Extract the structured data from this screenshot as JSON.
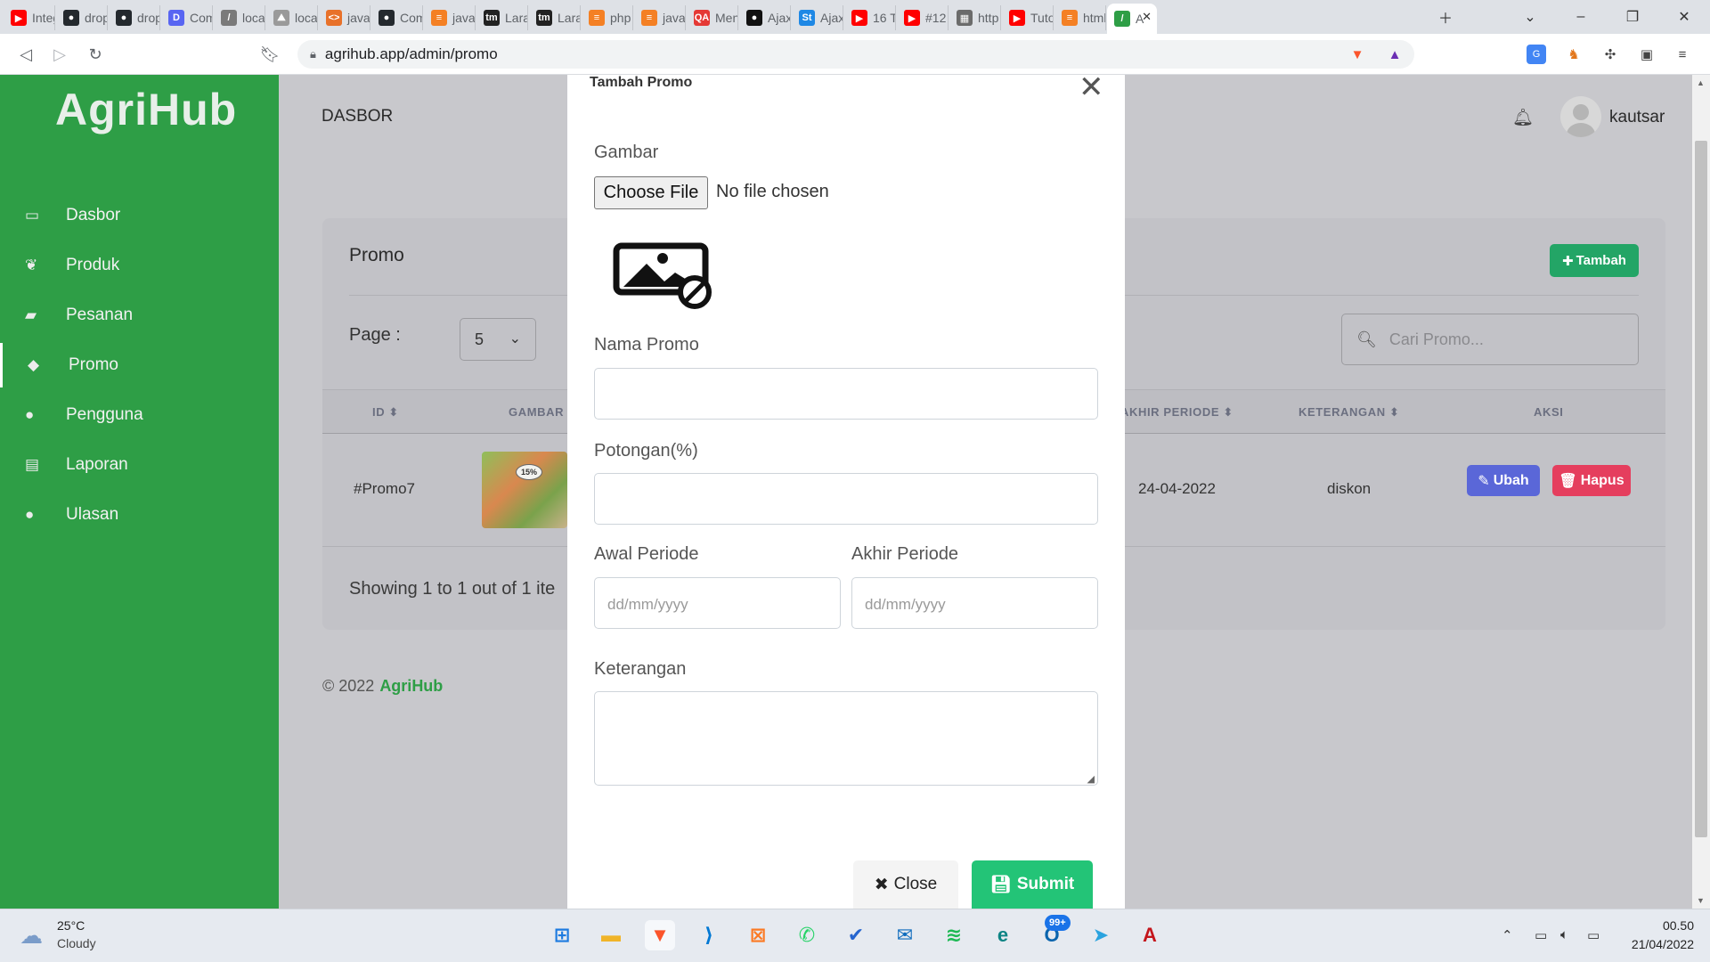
{
  "browser": {
    "tabs": [
      {
        "label": "Integ",
        "icon": "youtube-icon",
        "color": "#ff0000",
        "glyph": "▶"
      },
      {
        "label": "drop",
        "icon": "github-icon",
        "color": "#24292e",
        "glyph": "●"
      },
      {
        "label": "drop",
        "icon": "github-icon",
        "color": "#24292e",
        "glyph": "●"
      },
      {
        "label": "Com",
        "icon": "discord-icon",
        "color": "#5865f2",
        "glyph": "D"
      },
      {
        "label": "local",
        "icon": "leaf-icon",
        "color": "#7a7a7a",
        "glyph": "/"
      },
      {
        "label": "local",
        "icon": "phpmyadmin-icon",
        "color": "#9a9a9a",
        "glyph": "⛰"
      },
      {
        "label": "javas",
        "icon": "code-icon",
        "color": "#e8712a",
        "glyph": "<>"
      },
      {
        "label": "Com",
        "icon": "github-icon",
        "color": "#24292e",
        "glyph": "●"
      },
      {
        "label": "javas",
        "icon": "stackoverflow-icon",
        "color": "#f48024",
        "glyph": "≡"
      },
      {
        "label": "Lara",
        "icon": "tm-icon",
        "color": "#222222",
        "glyph": "tm"
      },
      {
        "label": "Lara",
        "icon": "tm-icon",
        "color": "#222222",
        "glyph": "tm"
      },
      {
        "label": "php",
        "icon": "stackoverflow-icon",
        "color": "#f48024",
        "glyph": "≡"
      },
      {
        "label": "javas",
        "icon": "stackoverflow-icon",
        "color": "#f48024",
        "glyph": "≡"
      },
      {
        "label": "Men",
        "icon": "qa-icon",
        "color": "#e53935",
        "glyph": "QA"
      },
      {
        "label": "Ajax",
        "icon": "globe-icon",
        "color": "#111111",
        "glyph": "●"
      },
      {
        "label": "Ajax",
        "icon": "st-icon",
        "color": "#1e88e5",
        "glyph": "St"
      },
      {
        "label": "16 T",
        "icon": "youtube-icon",
        "color": "#ff0000",
        "glyph": "▶"
      },
      {
        "label": "#12",
        "icon": "youtube-icon",
        "color": "#ff0000",
        "glyph": "▶"
      },
      {
        "label": "http",
        "icon": "page-icon",
        "color": "#6b6b6b",
        "glyph": "▦"
      },
      {
        "label": "Tuto",
        "icon": "youtube-icon",
        "color": "#ff0000",
        "glyph": "▶"
      },
      {
        "label": "html",
        "icon": "stackoverflow-icon",
        "color": "#f48024",
        "glyph": "≡"
      },
      {
        "label": "A",
        "icon": "leaf-icon",
        "color": "#2e9e46",
        "glyph": "/",
        "active": true
      }
    ],
    "url": "agrihub.app/admin/promo"
  },
  "sidebar": {
    "logo": "AgriHub",
    "items": [
      {
        "label": "Dasbor",
        "icon": "monitor-icon",
        "glyph": "▭"
      },
      {
        "label": "Produk",
        "icon": "leaf-icon",
        "glyph": "❦"
      },
      {
        "label": "Pesanan",
        "icon": "shopping-bag-icon",
        "glyph": "▰"
      },
      {
        "label": "Promo",
        "icon": "tag-icon",
        "glyph": "◆",
        "active": true
      },
      {
        "label": "Pengguna",
        "icon": "user-icon",
        "glyph": "●"
      },
      {
        "label": "Laporan",
        "icon": "report-icon",
        "glyph": "▤"
      },
      {
        "label": "Ulasan",
        "icon": "chat-icon",
        "glyph": "●"
      }
    ]
  },
  "topbar": {
    "title": "DASBOR",
    "username": "kautsar"
  },
  "card": {
    "title": "Promo",
    "add_label": "Tambah",
    "page_label": "Page :",
    "page_value": "5",
    "search_placeholder": "Cari Promo...",
    "columns": {
      "id": "ID",
      "gambar": "GAMBAR",
      "akhir_periode": "AKHIR PERIODE",
      "keterangan": "KETERANGAN",
      "aksi": "AKSI"
    },
    "row": {
      "id": "#Promo7",
      "image_badge": "15%",
      "akhir_periode": "24-04-2022",
      "keterangan": "diskon",
      "edit_label": "Ubah",
      "delete_label": "Hapus"
    },
    "footer": "Showing 1 to 1 out of 1 ite"
  },
  "footer": {
    "copyright": "© 2022",
    "brand": "AgriHub"
  },
  "modal": {
    "title": "Tambah Promo",
    "gambar_label": "Gambar",
    "file_button": "Choose File",
    "file_status": "No file chosen",
    "nama_label": "Nama Promo",
    "nama_value": "",
    "potongan_label": "Potongan(%)",
    "potongan_value": "",
    "awal_label": "Awal Periode",
    "akhir_label": "Akhir Periode",
    "date_placeholder": "dd/mm/yyyy",
    "keterangan_label": "Keterangan",
    "keterangan_value": "",
    "close_label": "Close",
    "submit_label": "Submit"
  },
  "colors": {
    "sidebar": "#2e9e46",
    "add_button": "#23a566",
    "edit_button": "#5a67d8",
    "delete_button": "#e53e5e",
    "submit_button": "#23c477"
  },
  "taskbar": {
    "temperature": "25°C",
    "weather": "Cloudy",
    "badge": "99+",
    "time": "00.50",
    "date": "21/04/2022",
    "apps": [
      {
        "icon": "windows-start-icon",
        "color": "#1e7be0",
        "glyph": "⊞"
      },
      {
        "icon": "file-explorer-icon",
        "color": "#f0b429",
        "glyph": "▬"
      },
      {
        "icon": "brave-browser-icon",
        "color": "#fb542b",
        "glyph": "▼"
      },
      {
        "icon": "vscode-icon",
        "color": "#0078d4",
        "glyph": "⟩"
      },
      {
        "icon": "xampp-icon",
        "color": "#fb7a24",
        "glyph": "⊠"
      },
      {
        "icon": "whatsapp-icon",
        "color": "#25d366",
        "glyph": "✆"
      },
      {
        "icon": "todo-icon",
        "color": "#2564cf",
        "glyph": "✔"
      },
      {
        "icon": "mail-icon",
        "color": "#0f6cbd",
        "glyph": "✉"
      },
      {
        "icon": "spotify-icon",
        "color": "#1db954",
        "glyph": "≋"
      },
      {
        "icon": "edge-icon",
        "color": "#0c8484",
        "glyph": "e"
      },
      {
        "icon": "outlook-icon",
        "color": "#0a64ad",
        "glyph": "O"
      },
      {
        "icon": "telegram-icon",
        "color": "#2aa3df",
        "glyph": "➤"
      },
      {
        "icon": "acrobat-icon",
        "color": "#c4161c",
        "glyph": "A"
      }
    ]
  }
}
